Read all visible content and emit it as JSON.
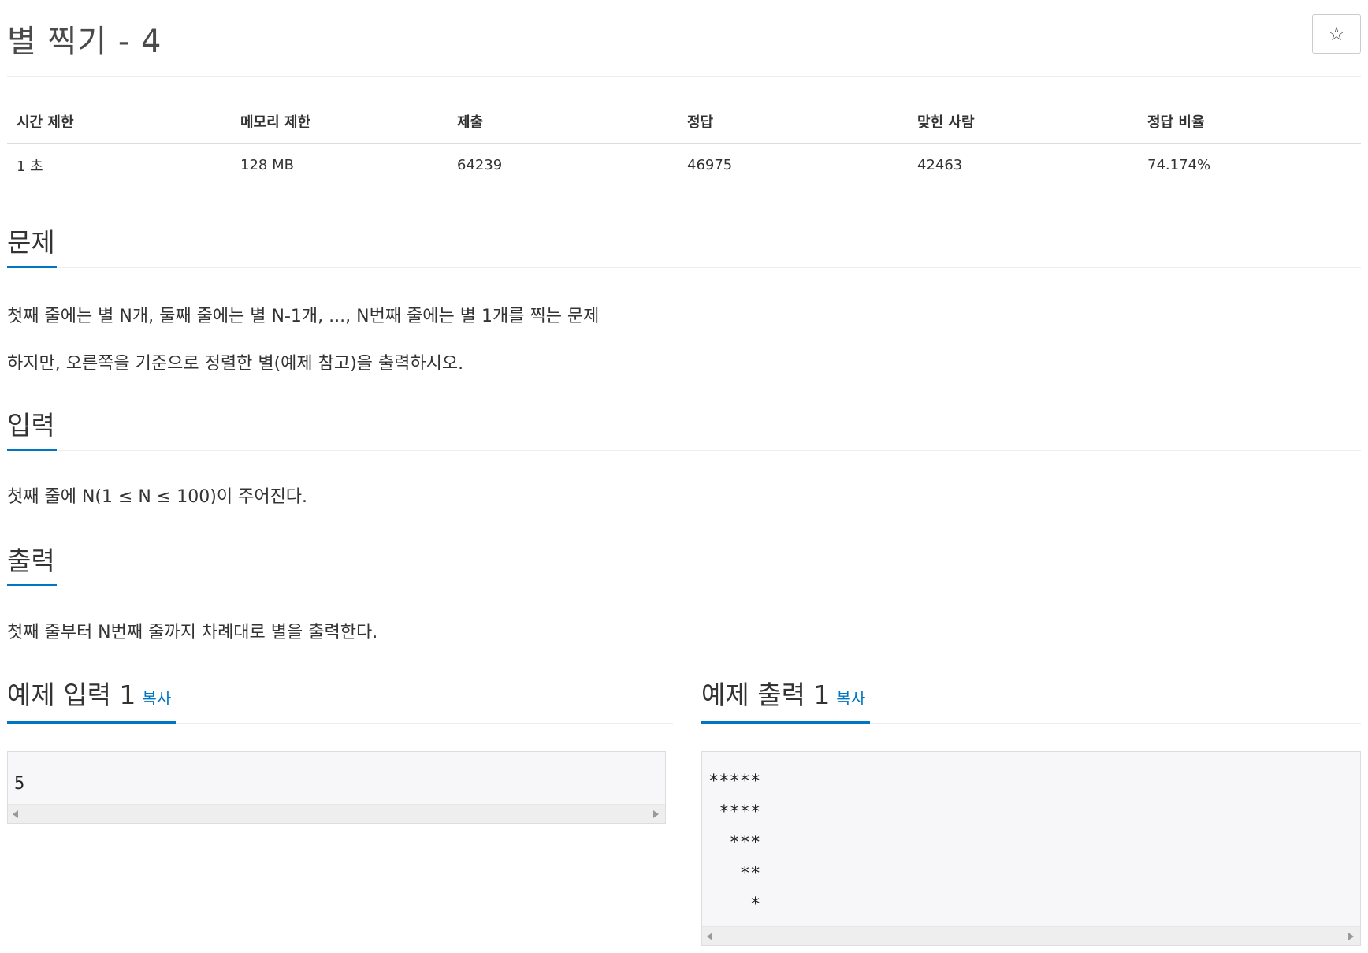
{
  "problem": {
    "title": "별 찍기 - 4",
    "star_button": "☆"
  },
  "stats": {
    "headers": [
      "시간 제한",
      "메모리 제한",
      "제출",
      "정답",
      "맞힌 사람",
      "정답 비율"
    ],
    "values": [
      "1 초",
      "128 MB",
      "64239",
      "46975",
      "42463",
      "74.174%"
    ]
  },
  "sections": {
    "problem": {
      "heading": "문제",
      "lines": [
        "첫째 줄에는 별 N개, 둘째 줄에는 별 N-1개, ..., N번째 줄에는 별 1개를 찍는 문제",
        "하지만, 오른쪽을 기준으로 정렬한 별(예제 참고)을 출력하시오."
      ]
    },
    "input": {
      "heading": "입력",
      "text": "첫째 줄에 N(1 ≤ N ≤ 100)이 주어진다."
    },
    "output": {
      "heading": "출력",
      "text": "첫째 줄부터 N번째 줄까지 차례대로 별을 출력한다."
    }
  },
  "samples": {
    "input": {
      "heading": "예제 입력 1",
      "copy_label": "복사",
      "content": "5"
    },
    "output": {
      "heading": "예제 출력 1",
      "copy_label": "복사",
      "content": "*****\n ****\n  ***\n   **\n    *"
    }
  },
  "colors": {
    "accent": "#0076c0",
    "pre_background": "#f7f7f9"
  }
}
